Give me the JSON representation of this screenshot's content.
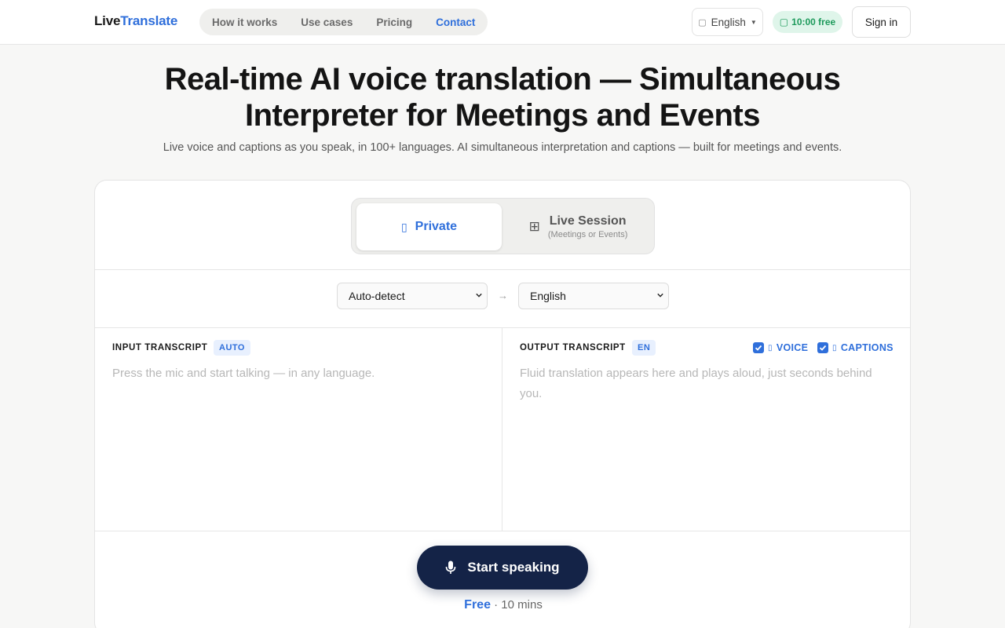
{
  "header": {
    "logo_part1": "Live",
    "logo_part2": "Translate",
    "nav": [
      {
        "label": "How it works"
      },
      {
        "label": "Use cases"
      },
      {
        "label": "Pricing"
      },
      {
        "label": "Contact"
      }
    ],
    "active_nav": "Contact",
    "language": "English",
    "free_time": "10:00 free",
    "signin_label": "Sign in"
  },
  "hero": {
    "title": "Real-time AI voice translation — Simultaneous Interpreter for Meetings and Events",
    "subtitle": "Live voice and captions as you speak, in 100+ languages. AI simultaneous interpretation and captions — built for meetings and events."
  },
  "modes": {
    "private_label": "Private",
    "live_label": "Live Session",
    "live_sub": "(Meetings or Events)",
    "selected": "Private"
  },
  "languages": {
    "source": "Auto-detect",
    "target": "English",
    "arrow": "→"
  },
  "input": {
    "label": "INPUT TRANSCRIPT",
    "tag": "AUTO",
    "placeholder": "Press the mic and start talking — in any language."
  },
  "output": {
    "label": "OUTPUT TRANSCRIPT",
    "tag": "EN",
    "placeholder": "Fluid translation appears here and plays aloud, just seconds behind you.",
    "voice_label": "VOICE",
    "voice_checked": true,
    "captions_label": "CAPTIONS",
    "captions_checked": true
  },
  "action": {
    "start_label": "Start speaking",
    "free_label": "Free",
    "duration_label": "· 10 mins"
  },
  "colors": {
    "accent": "#2f6fdb",
    "dark_button": "#142347",
    "badge_green": "#1d9a5b"
  },
  "icons": [
    "globe-icon",
    "clock-icon",
    "lock-icon",
    "grid-icon",
    "speaker-icon",
    "captions-icon",
    "mic-icon"
  ]
}
